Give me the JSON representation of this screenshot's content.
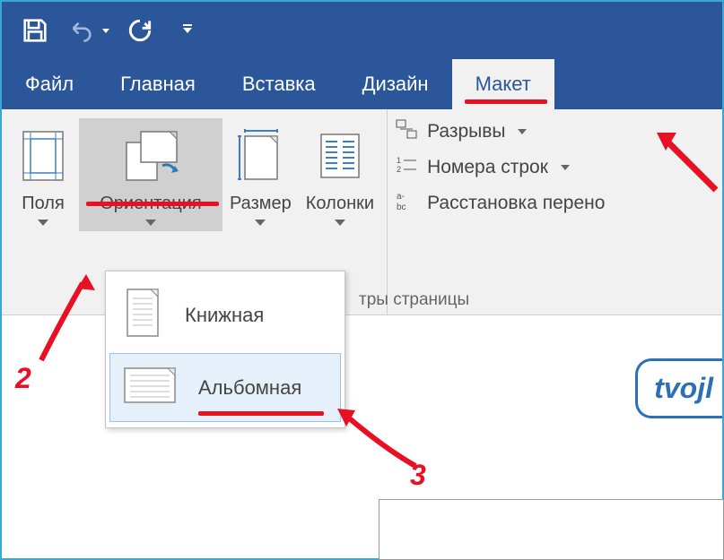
{
  "tabs": {
    "file": "Файл",
    "home": "Главная",
    "insert": "Вставка",
    "design": "Дизайн",
    "layout": "Макет"
  },
  "ribbon": {
    "margins": "Поля",
    "orientation": "Ориентация",
    "size": "Размер",
    "columns": "Колонки",
    "breaks": "Разрывы",
    "line_numbers": "Номера строк",
    "hyphenation": "Расстановка перено",
    "group_label": "тры страницы"
  },
  "orientation_menu": {
    "portrait": "Книжная",
    "landscape": "Альбомная"
  },
  "annotations": {
    "n2": "2",
    "n3": "3"
  },
  "watermark": "tvojl"
}
